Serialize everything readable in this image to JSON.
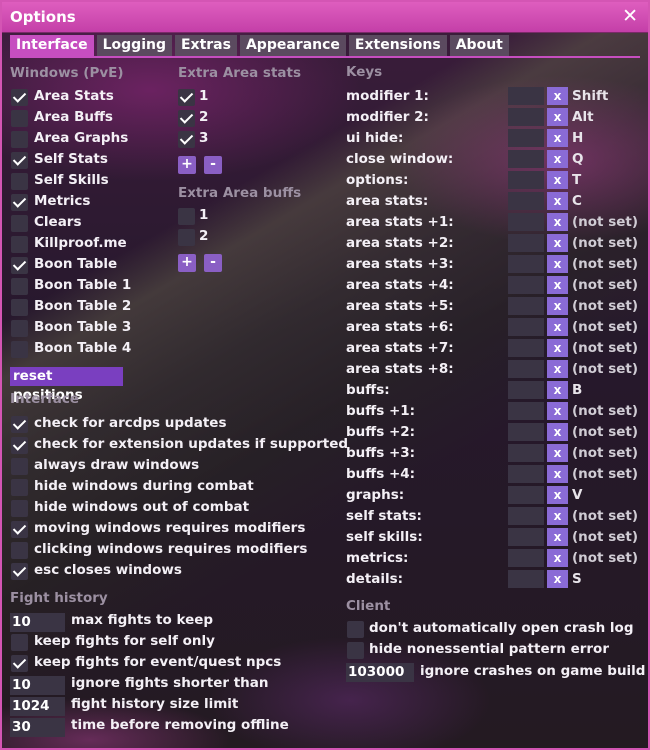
{
  "window": {
    "title": "Options",
    "close_glyph": "✕"
  },
  "tabs": [
    "Interface",
    "Logging",
    "Extras",
    "Appearance",
    "Extensions",
    "About"
  ],
  "windows_pve": {
    "header": "Windows (PvE)",
    "items": [
      {
        "label": "Area Stats",
        "checked": true
      },
      {
        "label": "Area Buffs",
        "checked": false
      },
      {
        "label": "Area Graphs",
        "checked": false
      },
      {
        "label": "Self Stats",
        "checked": true
      },
      {
        "label": "Self Skills",
        "checked": false
      },
      {
        "label": "Metrics",
        "checked": true
      },
      {
        "label": "Clears",
        "checked": false
      },
      {
        "label": "Killproof.me",
        "checked": false
      },
      {
        "label": "Boon Table",
        "checked": true
      },
      {
        "label": "Boon Table 1",
        "checked": false
      },
      {
        "label": "Boon Table 2",
        "checked": false
      },
      {
        "label": "Boon Table 3",
        "checked": false
      },
      {
        "label": "Boon Table 4",
        "checked": false
      }
    ]
  },
  "extra_area_stats": {
    "header": "Extra Area stats",
    "items": [
      {
        "label": "1",
        "checked": true
      },
      {
        "label": "2",
        "checked": true
      },
      {
        "label": "3",
        "checked": true
      }
    ],
    "plus": "+",
    "minus": "-"
  },
  "extra_area_buffs": {
    "header": "Extra Area buffs",
    "items": [
      {
        "label": "1",
        "checked": false
      },
      {
        "label": "2",
        "checked": false
      }
    ],
    "plus": "+",
    "minus": "-"
  },
  "reset_positions": "reset positions",
  "interface": {
    "header": "Interface",
    "items": [
      {
        "label": "check for arcdps updates",
        "checked": true
      },
      {
        "label": "check for extension updates if supported",
        "checked": true
      },
      {
        "label": "always draw windows",
        "checked": false
      },
      {
        "label": "hide windows during combat",
        "checked": false
      },
      {
        "label": "hide windows out of combat",
        "checked": false
      },
      {
        "label": "moving windows requires modifiers",
        "checked": true
      },
      {
        "label": "clicking windows requires modifiers",
        "checked": false
      },
      {
        "label": "esc closes windows",
        "checked": true
      }
    ]
  },
  "fight_history": {
    "header": "Fight history",
    "rows": [
      {
        "type": "num",
        "value": "10",
        "label": "max fights to keep"
      },
      {
        "type": "check",
        "checked": false,
        "label": "keep fights for self only"
      },
      {
        "type": "check",
        "checked": true,
        "label": "keep fights for event/quest npcs"
      },
      {
        "type": "num",
        "value": "10",
        "label": "ignore fights shorter than"
      },
      {
        "type": "num",
        "value": "1024",
        "label": "fight history size limit"
      },
      {
        "type": "num",
        "value": "30",
        "label": "time before removing offline"
      }
    ]
  },
  "keys": {
    "header": "Keys",
    "clear_glyph": "x",
    "rows": [
      {
        "label": "modifier 1:",
        "value": "Shift"
      },
      {
        "label": "modifier 2:",
        "value": "Alt"
      },
      {
        "label": "ui hide:",
        "value": "H"
      },
      {
        "label": "close window:",
        "value": "Q"
      },
      {
        "label": "options:",
        "value": "T"
      },
      {
        "label": "area stats:",
        "value": "C"
      },
      {
        "label": "area stats +1:",
        "value": "(not set)"
      },
      {
        "label": "area stats +2:",
        "value": "(not set)"
      },
      {
        "label": "area stats +3:",
        "value": "(not set)"
      },
      {
        "label": "area stats +4:",
        "value": "(not set)"
      },
      {
        "label": "area stats +5:",
        "value": "(not set)"
      },
      {
        "label": "area stats +6:",
        "value": "(not set)"
      },
      {
        "label": "area stats +7:",
        "value": "(not set)"
      },
      {
        "label": "area stats +8:",
        "value": "(not set)"
      },
      {
        "label": "buffs:",
        "value": "B"
      },
      {
        "label": "buffs +1:",
        "value": "(not set)"
      },
      {
        "label": "buffs +2:",
        "value": "(not set)"
      },
      {
        "label": "buffs +3:",
        "value": "(not set)"
      },
      {
        "label": "buffs +4:",
        "value": "(not set)"
      },
      {
        "label": "graphs:",
        "value": "V"
      },
      {
        "label": "self stats:",
        "value": "(not set)"
      },
      {
        "label": "self skills:",
        "value": "(not set)"
      },
      {
        "label": "metrics:",
        "value": "(not set)"
      },
      {
        "label": "details:",
        "value": "S"
      }
    ]
  },
  "client": {
    "header": "Client",
    "items": [
      {
        "label": "don't automatically open crash log",
        "checked": false
      },
      {
        "label": "hide nonessential pattern error",
        "checked": false
      }
    ],
    "build_value": "103000",
    "build_label": "ignore crashes on game build"
  },
  "colors": {
    "accent": "#c64ec0",
    "titlebar": "#d455b4",
    "button": "#8a6bd6",
    "header": "#9c90a2"
  }
}
